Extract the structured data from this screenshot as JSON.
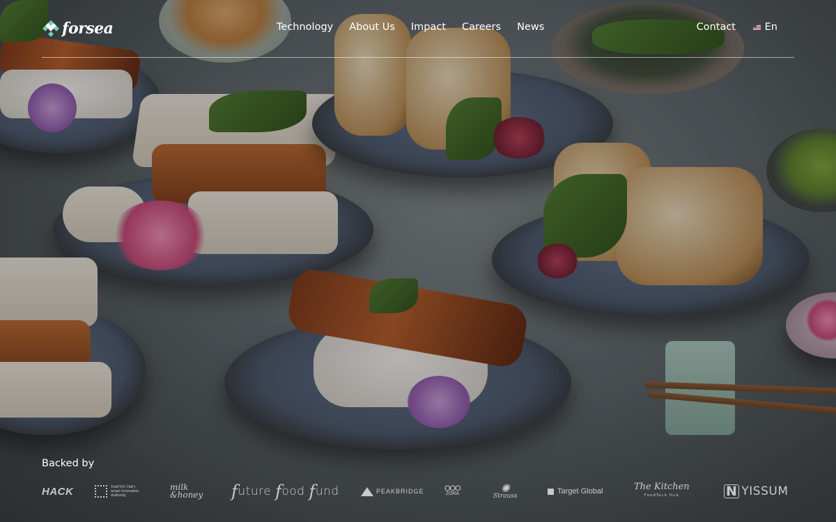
{
  "site": {
    "logo_text": "forsea",
    "brand_color": "#6fd1b0"
  },
  "nav": {
    "items": [
      {
        "label": "Technology"
      },
      {
        "label": "About Us"
      },
      {
        "label": "Impact"
      },
      {
        "label": "Careers"
      },
      {
        "label": "News"
      }
    ],
    "contact_label": "Contact",
    "language_label": "En",
    "language_icon": "us-flag-icon"
  },
  "backers": {
    "label": "Backed by",
    "logos": [
      {
        "name": "HACK",
        "text": "HACK"
      },
      {
        "name": "Israel Innovation Authority",
        "line1": "רשות החדשנות",
        "line2": "Israel Innovation",
        "line3": "Authority"
      },
      {
        "name": "milk & honey",
        "line1": "milk",
        "line2": "&honey"
      },
      {
        "name": "future food fund",
        "w1": "uture",
        "w2": "ood",
        "w3": "und",
        "f": "f"
      },
      {
        "name": "PeakBridge",
        "text": "PEAKBRIDGE"
      },
      {
        "name": "Zora",
        "dots": "OOO",
        "text": "ZORA"
      },
      {
        "name": "Strauss",
        "text": "Strauss"
      },
      {
        "name": "Target Global",
        "text": "Target Global"
      },
      {
        "name": "The Kitchen",
        "line1": "The Kitchen",
        "line2": "FoodTech Hub"
      },
      {
        "name": "Yissum",
        "mark": "N",
        "text": "YISSUM"
      }
    ]
  }
}
